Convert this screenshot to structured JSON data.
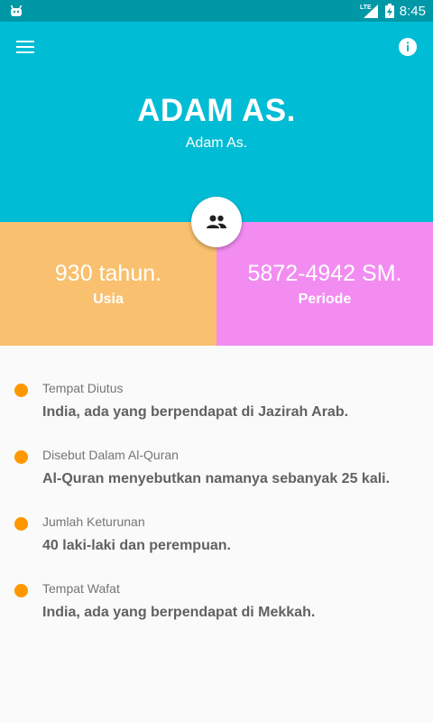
{
  "status_bar": {
    "time": "8:45",
    "network": "LTE",
    "icons": [
      "android-robot-icon",
      "signal-icon",
      "battery-charging-icon"
    ]
  },
  "colors": {
    "status_bar": "#0097a7",
    "header": "#00bcd4",
    "age_card": "#f9c06f",
    "period_card": "#f28cf1",
    "bullet": "#ff9800"
  },
  "header": {
    "title": "ADAM AS.",
    "subtitle": "Adam As.",
    "menu_icon": "menu-icon",
    "info_icon": "info-icon",
    "fab_icon": "people-icon"
  },
  "stats": {
    "age": {
      "value": "930 tahun.",
      "label": "Usia"
    },
    "period": {
      "value": "5872-4942 SM.",
      "label": "Periode"
    }
  },
  "details": [
    {
      "key": "Tempat Diutus",
      "value": "India, ada yang berpendapat di Jazirah Arab."
    },
    {
      "key": "Disebut Dalam Al-Quran",
      "value": "Al-Quran menyebutkan namanya sebanyak 25 kali."
    },
    {
      "key": "Jumlah Keturunan",
      "value": "40 laki-laki dan perempuan."
    },
    {
      "key": "Tempat Wafat",
      "value": "India, ada yang berpendapat di Mekkah."
    }
  ]
}
